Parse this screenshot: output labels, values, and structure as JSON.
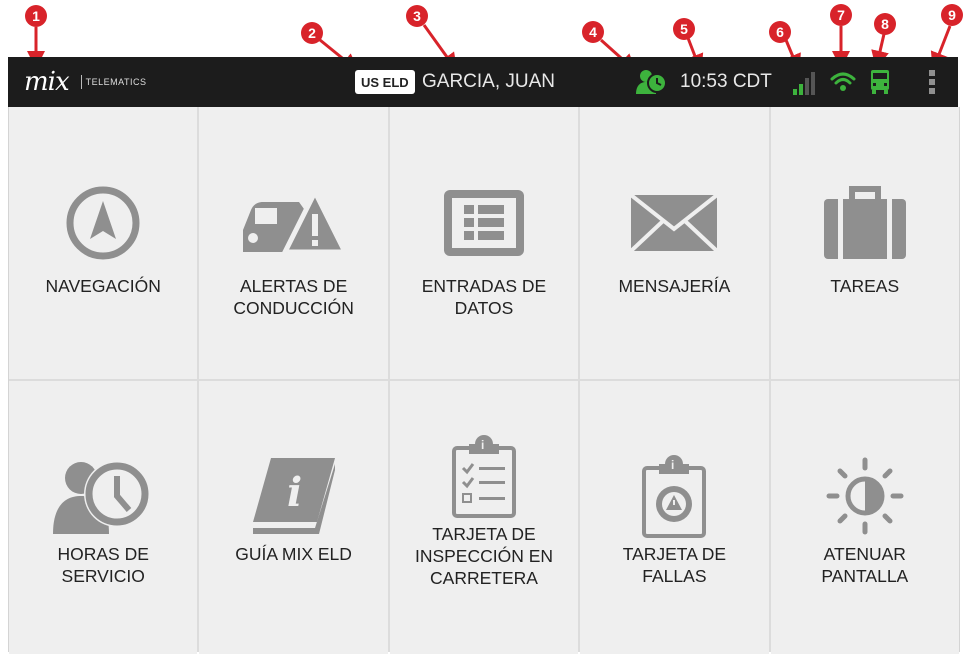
{
  "callouts": [
    "1",
    "2",
    "3",
    "4",
    "5",
    "6",
    "7",
    "8",
    "9"
  ],
  "header": {
    "logo_mark": "mix",
    "logo_sub": "TELEMATICS",
    "eld_badge": "US ELD",
    "driver_name": "GARCIA, JUAN",
    "time": "10:53 CDT"
  },
  "icons": {
    "status": "driver-status-icon",
    "signal": "signal-strength-icon",
    "wifi": "wifi-icon",
    "truck": "vehicle-connection-icon",
    "menu": "overflow-menu-icon"
  },
  "colors": {
    "status_green": "#3db33d",
    "icon_gray": "#8f8f8f",
    "callout_red": "#d8232a"
  },
  "tiles": [
    {
      "label": "NAVEGACIÓN",
      "icon": "navigation-icon"
    },
    {
      "label": "ALERTAS DE\nCONDUCCIÓN",
      "icon": "driving-alerts-icon"
    },
    {
      "label": "ENTRADAS DE\nDATOS",
      "icon": "data-entries-icon"
    },
    {
      "label": "MENSAJERÍA",
      "icon": "messaging-icon"
    },
    {
      "label": "TAREAS",
      "icon": "tasks-icon"
    },
    {
      "label": "HORAS DE\nSERVICIO",
      "icon": "hours-of-service-icon"
    },
    {
      "label": "GUÍA MIX ELD",
      "icon": "guide-icon"
    },
    {
      "label": "TARJETA DE\nINSPECCIÓN EN\nCARRETERA",
      "icon": "inspection-card-icon"
    },
    {
      "label": "TARJETA DE\nFALLAS",
      "icon": "faults-card-icon"
    },
    {
      "label": "ATENUAR\nPANTALLA",
      "icon": "dim-screen-icon"
    }
  ]
}
